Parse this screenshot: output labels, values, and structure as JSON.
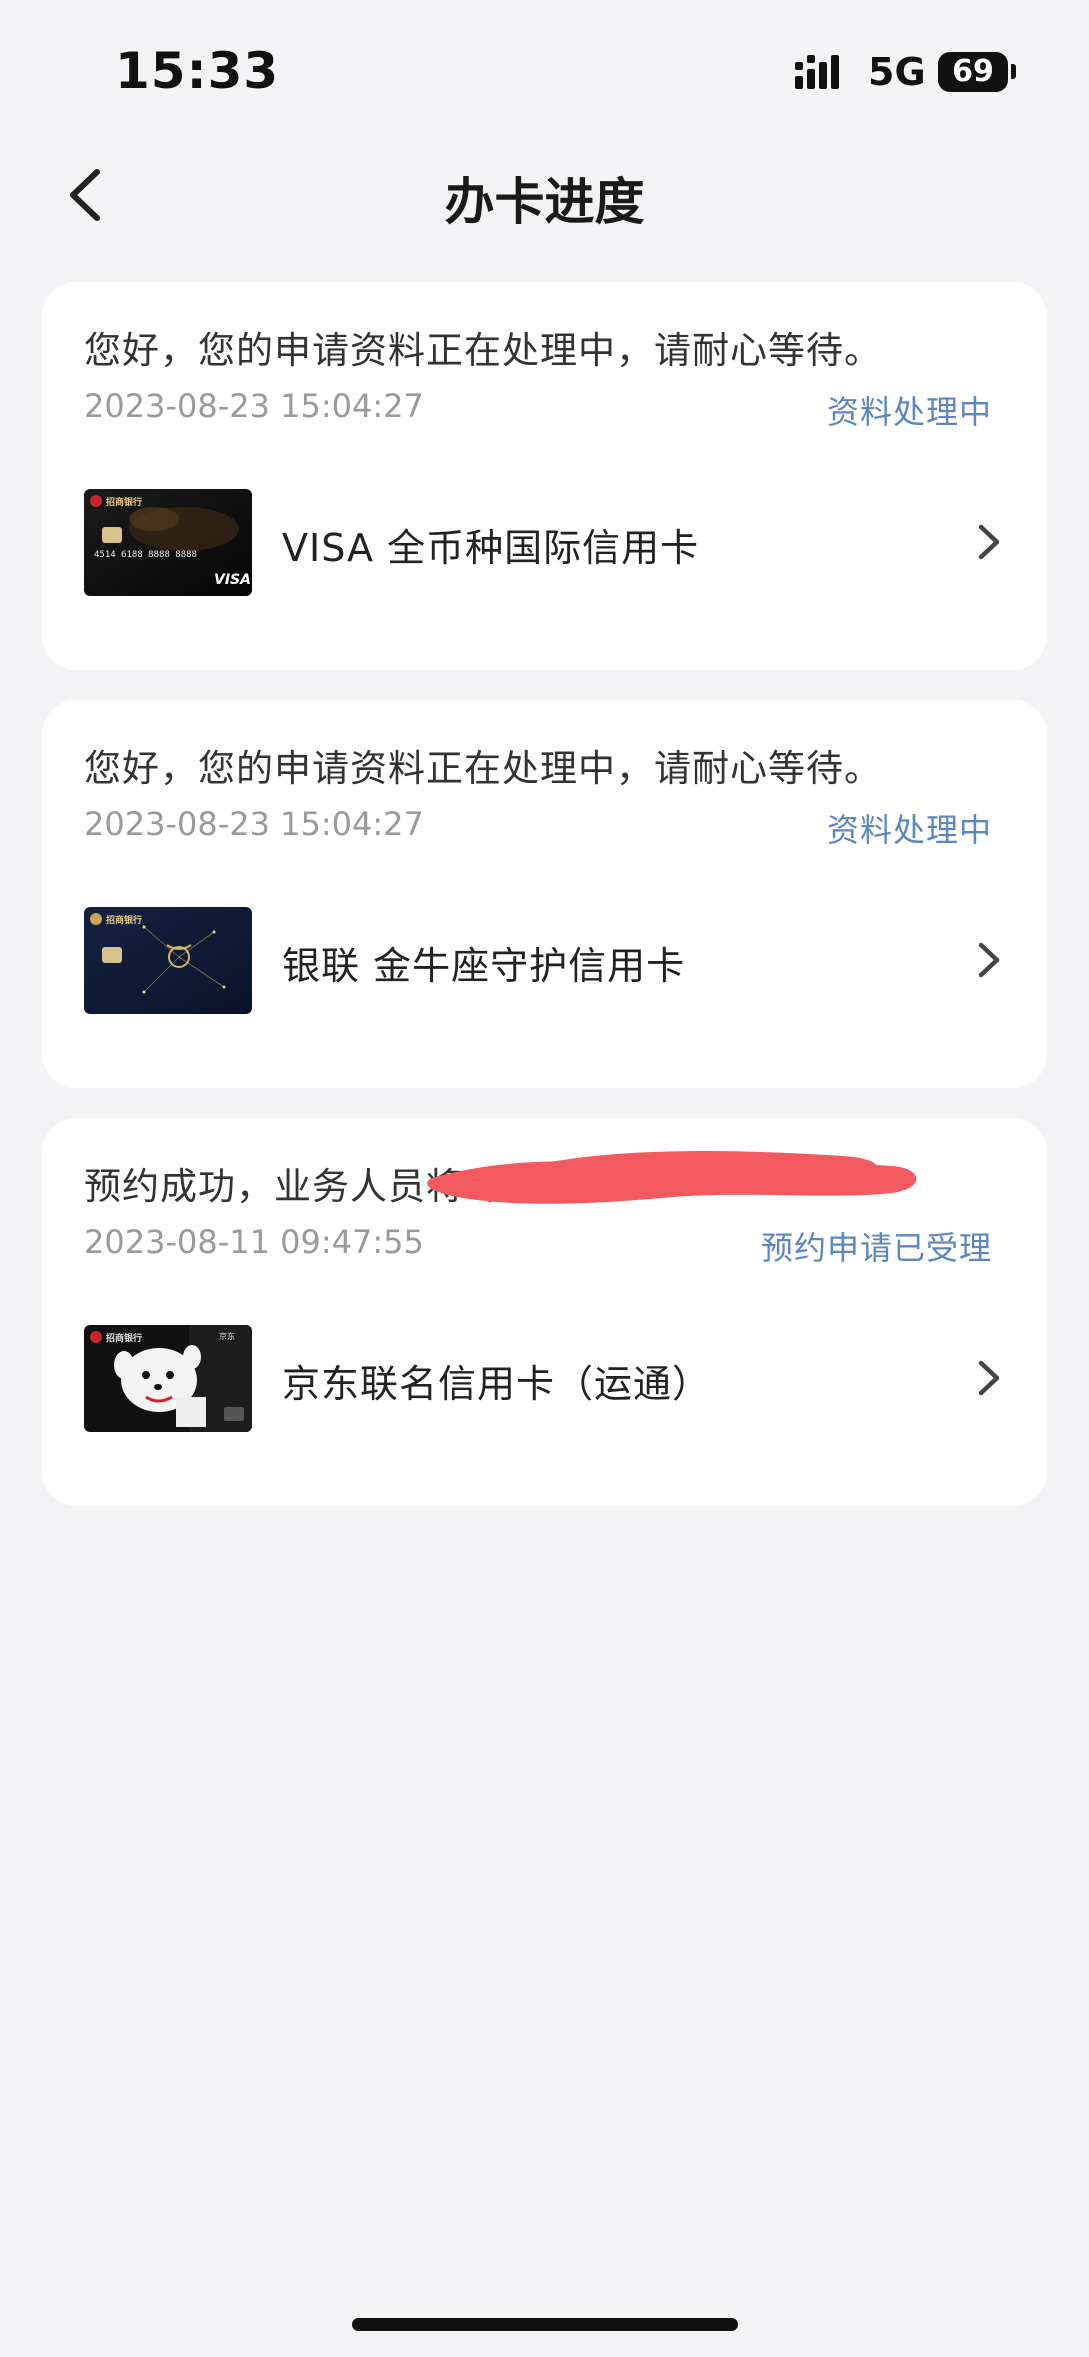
{
  "status_bar": {
    "time": "15:33",
    "network": "5G",
    "battery": "69"
  },
  "nav": {
    "title": "办卡进度"
  },
  "applications": [
    {
      "message": "您好，您的申请资料正在处理中，请耐心等待。",
      "date": "2023-08-23 15:04:27",
      "status": "资料处理中",
      "card_name": "VISA 全币种国际信用卡",
      "card_number": "4514 6188 8888 8888",
      "card_brand": "VISA",
      "bank_logo": "招商银行"
    },
    {
      "message": "您好，您的申请资料正在处理中，请耐心等待。",
      "date": "2023-08-23 15:04:27",
      "status": "资料处理中",
      "card_name": "银联 金牛座守护信用卡",
      "bank_logo": "招商银行"
    },
    {
      "message": "预约成功，业务人员将尽快…",
      "date": "2023-08-11 09:47:55",
      "status": "预约申请已受理",
      "card_name": "京东联名信用卡（运通）",
      "bank_logo": "招商银行",
      "partner": "京东"
    }
  ],
  "colors": {
    "status_blue": "#5b86c2",
    "background": "#f4f4f6",
    "card_bg": "#ffffff",
    "redaction": "#f25a5f"
  }
}
